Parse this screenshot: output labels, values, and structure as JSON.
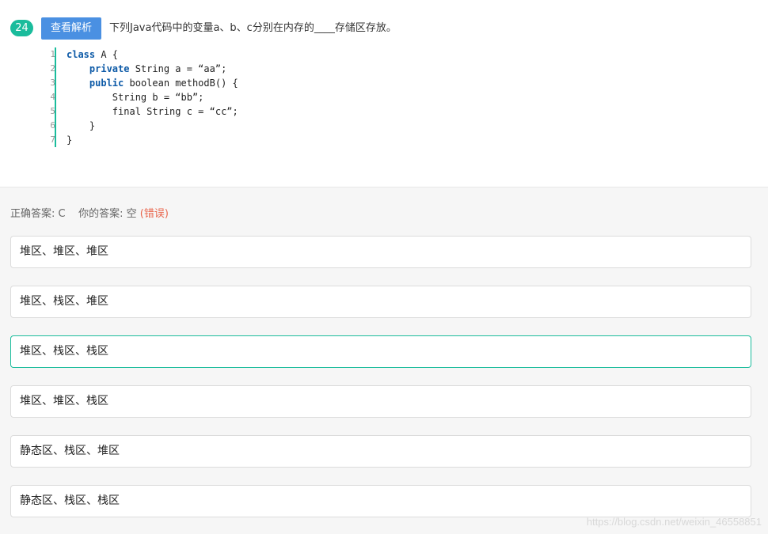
{
  "question": {
    "number": "24",
    "analysis_button": "查看解析",
    "text": "下列Java代码中的变量a、b、c分别在内存的____存储区存放。"
  },
  "code": {
    "lines": [
      {
        "no": "1",
        "kw": "class",
        "rest": " A {",
        "indent": ""
      },
      {
        "no": "2",
        "kw": "private",
        "rest": " String a = “aa”;",
        "indent": "    "
      },
      {
        "no": "3",
        "kw": "public",
        "rest": " boolean methodB() {",
        "indent": "    "
      },
      {
        "no": "4",
        "kw": "",
        "rest": "String b = “bb”;",
        "indent": "        "
      },
      {
        "no": "5",
        "kw": "",
        "rest": "final String c = “cc”;",
        "indent": "        "
      },
      {
        "no": "6",
        "kw": "",
        "rest": "}",
        "indent": "    "
      },
      {
        "no": "7",
        "kw": "",
        "rest": "}",
        "indent": ""
      }
    ]
  },
  "answer": {
    "correct_label": "正确答案: C",
    "yours_label": "你的答案: 空",
    "status": "(错误)"
  },
  "options": [
    {
      "text": "堆区、堆区、堆区",
      "correct": false
    },
    {
      "text": "堆区、栈区、堆区",
      "correct": false
    },
    {
      "text": "堆区、栈区、栈区",
      "correct": true
    },
    {
      "text": "堆区、堆区、栈区",
      "correct": false
    },
    {
      "text": "静态区、栈区、堆区",
      "correct": false
    },
    {
      "text": "静态区、栈区、栈区",
      "correct": false
    }
  ],
  "watermark": "https://blog.csdn.net/weixin_46558851",
  "colors": {
    "accent": "#1abc9c",
    "button": "#4a90e2",
    "error": "#e9674e"
  }
}
